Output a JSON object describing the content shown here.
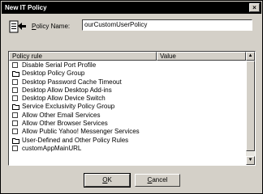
{
  "window": {
    "title": "New IT Policy",
    "close_glyph": "×"
  },
  "form": {
    "icon": "policy-icon",
    "label_prefix": "P",
    "label_rest": "olicy Name:",
    "name_value": "ourCustomUserPolicy"
  },
  "list": {
    "columns": [
      "Policy rule",
      "Value"
    ],
    "items": [
      {
        "label": "Disable Serial Port Profile",
        "kind": "checkbox"
      },
      {
        "label": "Desktop Policy Group",
        "kind": "folder"
      },
      {
        "label": "Desktop Password Cache Timeout",
        "kind": "checkbox"
      },
      {
        "label": "Desktop Allow Desktop Add-ins",
        "kind": "checkbox"
      },
      {
        "label": "Desktop Allow Device Switch",
        "kind": "checkbox"
      },
      {
        "label": "Service Exclusivity Policy Group",
        "kind": "folder"
      },
      {
        "label": "Allow Other Email Services",
        "kind": "checkbox"
      },
      {
        "label": "Allow Other Browser Services",
        "kind": "checkbox"
      },
      {
        "label": "Allow Public Yahoo! Messenger Services",
        "kind": "checkbox"
      },
      {
        "label": "User-Defined and Other Policy Rules",
        "kind": "folder"
      },
      {
        "label": "customAppMainURL",
        "kind": "checkbox"
      }
    ],
    "scroll_up_glyph": "▲",
    "scroll_down_glyph": "▼"
  },
  "buttons": {
    "ok_prefix": "O",
    "ok_rest": "K",
    "cancel_prefix": "C",
    "cancel_rest": "ancel"
  }
}
